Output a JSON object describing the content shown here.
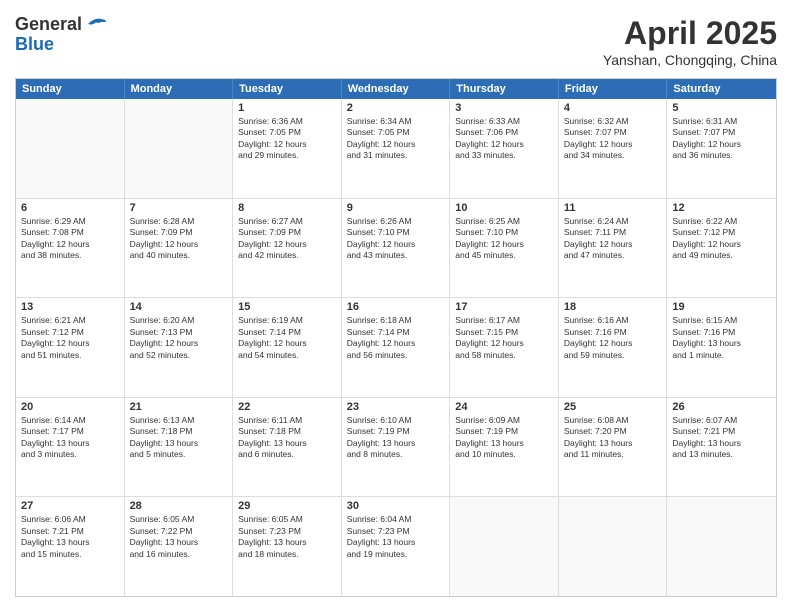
{
  "header": {
    "logo_general": "General",
    "logo_blue": "Blue",
    "title": "April 2025",
    "location": "Yanshan, Chongqing, China"
  },
  "days_of_week": [
    "Sunday",
    "Monday",
    "Tuesday",
    "Wednesday",
    "Thursday",
    "Friday",
    "Saturday"
  ],
  "weeks": [
    [
      {
        "day": "",
        "lines": []
      },
      {
        "day": "",
        "lines": []
      },
      {
        "day": "1",
        "lines": [
          "Sunrise: 6:36 AM",
          "Sunset: 7:05 PM",
          "Daylight: 12 hours",
          "and 29 minutes."
        ]
      },
      {
        "day": "2",
        "lines": [
          "Sunrise: 6:34 AM",
          "Sunset: 7:05 PM",
          "Daylight: 12 hours",
          "and 31 minutes."
        ]
      },
      {
        "day": "3",
        "lines": [
          "Sunrise: 6:33 AM",
          "Sunset: 7:06 PM",
          "Daylight: 12 hours",
          "and 33 minutes."
        ]
      },
      {
        "day": "4",
        "lines": [
          "Sunrise: 6:32 AM",
          "Sunset: 7:07 PM",
          "Daylight: 12 hours",
          "and 34 minutes."
        ]
      },
      {
        "day": "5",
        "lines": [
          "Sunrise: 6:31 AM",
          "Sunset: 7:07 PM",
          "Daylight: 12 hours",
          "and 36 minutes."
        ]
      }
    ],
    [
      {
        "day": "6",
        "lines": [
          "Sunrise: 6:29 AM",
          "Sunset: 7:08 PM",
          "Daylight: 12 hours",
          "and 38 minutes."
        ]
      },
      {
        "day": "7",
        "lines": [
          "Sunrise: 6:28 AM",
          "Sunset: 7:09 PM",
          "Daylight: 12 hours",
          "and 40 minutes."
        ]
      },
      {
        "day": "8",
        "lines": [
          "Sunrise: 6:27 AM",
          "Sunset: 7:09 PM",
          "Daylight: 12 hours",
          "and 42 minutes."
        ]
      },
      {
        "day": "9",
        "lines": [
          "Sunrise: 6:26 AM",
          "Sunset: 7:10 PM",
          "Daylight: 12 hours",
          "and 43 minutes."
        ]
      },
      {
        "day": "10",
        "lines": [
          "Sunrise: 6:25 AM",
          "Sunset: 7:10 PM",
          "Daylight: 12 hours",
          "and 45 minutes."
        ]
      },
      {
        "day": "11",
        "lines": [
          "Sunrise: 6:24 AM",
          "Sunset: 7:11 PM",
          "Daylight: 12 hours",
          "and 47 minutes."
        ]
      },
      {
        "day": "12",
        "lines": [
          "Sunrise: 6:22 AM",
          "Sunset: 7:12 PM",
          "Daylight: 12 hours",
          "and 49 minutes."
        ]
      }
    ],
    [
      {
        "day": "13",
        "lines": [
          "Sunrise: 6:21 AM",
          "Sunset: 7:12 PM",
          "Daylight: 12 hours",
          "and 51 minutes."
        ]
      },
      {
        "day": "14",
        "lines": [
          "Sunrise: 6:20 AM",
          "Sunset: 7:13 PM",
          "Daylight: 12 hours",
          "and 52 minutes."
        ]
      },
      {
        "day": "15",
        "lines": [
          "Sunrise: 6:19 AM",
          "Sunset: 7:14 PM",
          "Daylight: 12 hours",
          "and 54 minutes."
        ]
      },
      {
        "day": "16",
        "lines": [
          "Sunrise: 6:18 AM",
          "Sunset: 7:14 PM",
          "Daylight: 12 hours",
          "and 56 minutes."
        ]
      },
      {
        "day": "17",
        "lines": [
          "Sunrise: 6:17 AM",
          "Sunset: 7:15 PM",
          "Daylight: 12 hours",
          "and 58 minutes."
        ]
      },
      {
        "day": "18",
        "lines": [
          "Sunrise: 6:16 AM",
          "Sunset: 7:16 PM",
          "Daylight: 12 hours",
          "and 59 minutes."
        ]
      },
      {
        "day": "19",
        "lines": [
          "Sunrise: 6:15 AM",
          "Sunset: 7:16 PM",
          "Daylight: 13 hours",
          "and 1 minute."
        ]
      }
    ],
    [
      {
        "day": "20",
        "lines": [
          "Sunrise: 6:14 AM",
          "Sunset: 7:17 PM",
          "Daylight: 13 hours",
          "and 3 minutes."
        ]
      },
      {
        "day": "21",
        "lines": [
          "Sunrise: 6:13 AM",
          "Sunset: 7:18 PM",
          "Daylight: 13 hours",
          "and 5 minutes."
        ]
      },
      {
        "day": "22",
        "lines": [
          "Sunrise: 6:11 AM",
          "Sunset: 7:18 PM",
          "Daylight: 13 hours",
          "and 6 minutes."
        ]
      },
      {
        "day": "23",
        "lines": [
          "Sunrise: 6:10 AM",
          "Sunset: 7:19 PM",
          "Daylight: 13 hours",
          "and 8 minutes."
        ]
      },
      {
        "day": "24",
        "lines": [
          "Sunrise: 6:09 AM",
          "Sunset: 7:19 PM",
          "Daylight: 13 hours",
          "and 10 minutes."
        ]
      },
      {
        "day": "25",
        "lines": [
          "Sunrise: 6:08 AM",
          "Sunset: 7:20 PM",
          "Daylight: 13 hours",
          "and 11 minutes."
        ]
      },
      {
        "day": "26",
        "lines": [
          "Sunrise: 6:07 AM",
          "Sunset: 7:21 PM",
          "Daylight: 13 hours",
          "and 13 minutes."
        ]
      }
    ],
    [
      {
        "day": "27",
        "lines": [
          "Sunrise: 6:06 AM",
          "Sunset: 7:21 PM",
          "Daylight: 13 hours",
          "and 15 minutes."
        ]
      },
      {
        "day": "28",
        "lines": [
          "Sunrise: 6:05 AM",
          "Sunset: 7:22 PM",
          "Daylight: 13 hours",
          "and 16 minutes."
        ]
      },
      {
        "day": "29",
        "lines": [
          "Sunrise: 6:05 AM",
          "Sunset: 7:23 PM",
          "Daylight: 13 hours",
          "and 18 minutes."
        ]
      },
      {
        "day": "30",
        "lines": [
          "Sunrise: 6:04 AM",
          "Sunset: 7:23 PM",
          "Daylight: 13 hours",
          "and 19 minutes."
        ]
      },
      {
        "day": "",
        "lines": []
      },
      {
        "day": "",
        "lines": []
      },
      {
        "day": "",
        "lines": []
      }
    ]
  ]
}
